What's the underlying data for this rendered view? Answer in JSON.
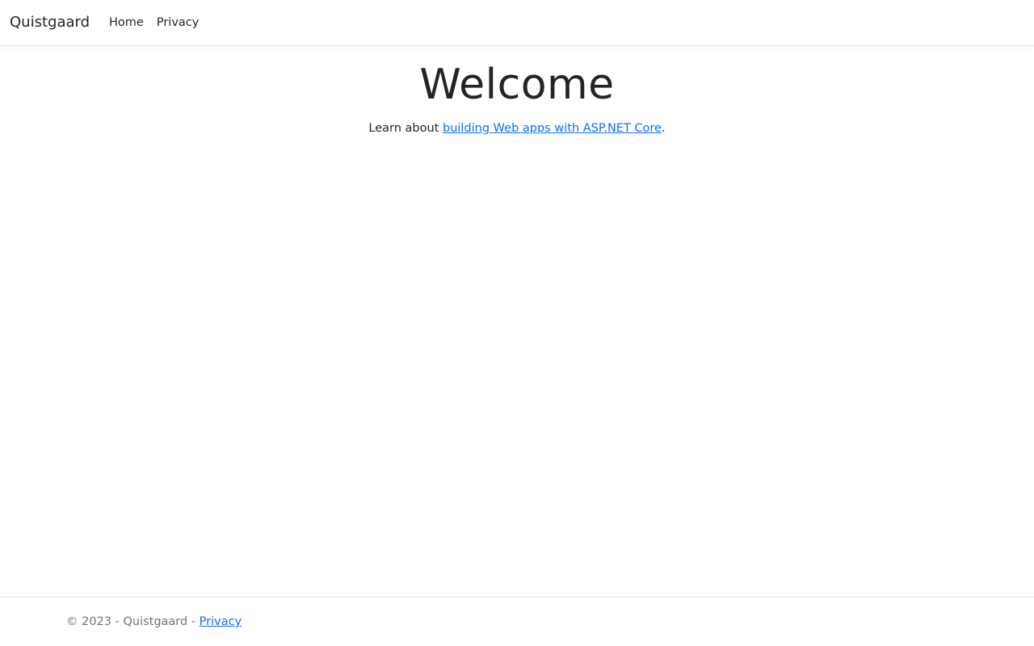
{
  "navbar": {
    "brand": "Quistgaard",
    "links": [
      {
        "label": "Home"
      },
      {
        "label": "Privacy"
      }
    ]
  },
  "main": {
    "title": "Welcome",
    "intro_prefix": "Learn about ",
    "intro_link": "building Web apps with ASP.NET Core",
    "intro_suffix": "."
  },
  "footer": {
    "copyright": "© 2023 - Quistgaard - ",
    "privacy_link": "Privacy"
  },
  "colors": {
    "text": "#212529",
    "link": "#0d6efd",
    "muted": "#6c757d",
    "border": "#dee2e6"
  }
}
